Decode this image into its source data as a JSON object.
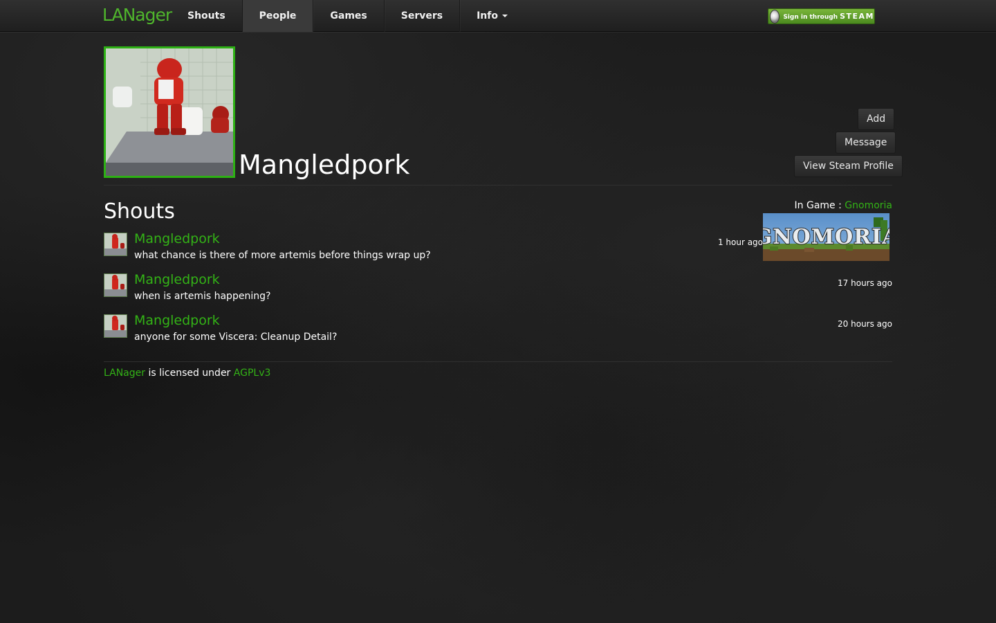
{
  "navbar": {
    "brand": "LANager",
    "items": [
      {
        "label": "Shouts",
        "active": false
      },
      {
        "label": "People",
        "active": true
      },
      {
        "label": "Games",
        "active": false
      },
      {
        "label": "Servers",
        "active": false
      },
      {
        "label": "Info",
        "active": false,
        "dropdown": true
      }
    ],
    "steam_signin": {
      "prefix": "Sign in through",
      "brand": "STEAM"
    }
  },
  "profile": {
    "name": "Mangledpork",
    "actions": [
      "Add",
      "Message",
      "View Steam Profile"
    ],
    "in_game": {
      "label": "In Game :",
      "game": "Gnomoria",
      "banner_text": "GNOMORIA"
    }
  },
  "shouts": {
    "title": "Shouts",
    "items": [
      {
        "author": "Mangledpork",
        "text": "what chance is there of more artemis before things wrap up?",
        "time": "1 hour ago"
      },
      {
        "author": "Mangledpork",
        "text": "when is artemis happening?",
        "time": "17 hours ago"
      },
      {
        "author": "Mangledpork",
        "text": "anyone for some Viscera: Cleanup Detail?",
        "time": "20 hours ago"
      }
    ]
  },
  "footer": {
    "link1": "LANager",
    "middle": " is licensed under ",
    "link2": "AGPLv3"
  },
  "colors": {
    "accent": "#33b316",
    "avatar_border": "#2db014",
    "background": "#1c1c1c"
  }
}
